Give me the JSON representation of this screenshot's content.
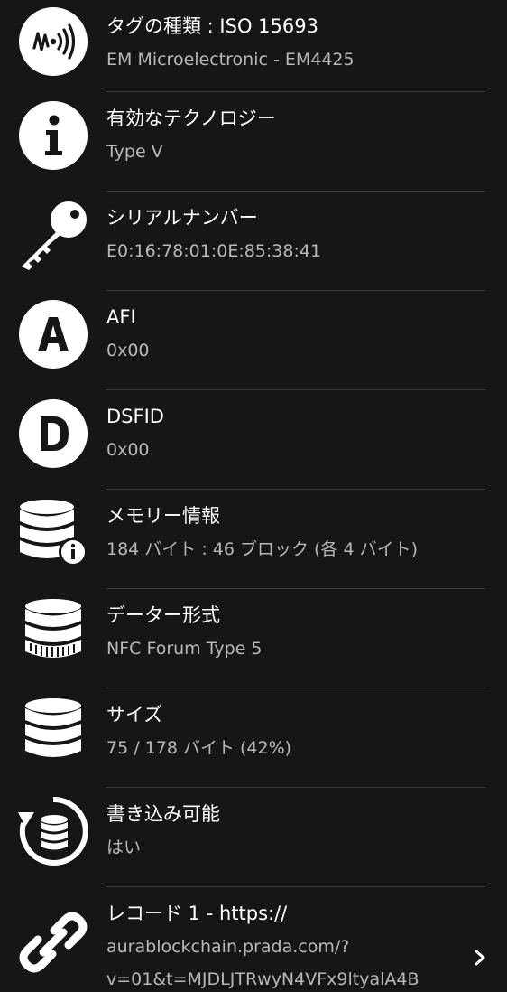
{
  "rows": [
    {
      "title": "タグの種類 : ISO 15693",
      "subtitle": "EM Microelectronic - EM4425",
      "icon": "nfc-tag-icon"
    },
    {
      "title": "有効なテクノロジー",
      "subtitle": "Type V",
      "icon": "info-icon"
    },
    {
      "title": "シリアルナンバー",
      "subtitle": "E0:16:78:01:0E:85:38:41",
      "icon": "key-icon"
    },
    {
      "title": "AFI",
      "subtitle": "0x00",
      "icon": "letter-a-icon"
    },
    {
      "title": "DSFID",
      "subtitle": "0x00",
      "icon": "letter-d-icon"
    },
    {
      "title": "メモリー情報",
      "subtitle": "184 バイト : 46 ブロック (各 4 バイト)",
      "icon": "database-info-icon"
    },
    {
      "title": "データー形式",
      "subtitle": "NFC Forum Type 5",
      "icon": "database-format-icon"
    },
    {
      "title": "サイズ",
      "subtitle": "75 / 178 バイト (42%)",
      "icon": "database-size-icon"
    },
    {
      "title": "書き込み可能",
      "subtitle": "はい",
      "icon": "writable-database-icon"
    },
    {
      "title": "レコード 1 - https://",
      "subtitle": "aurablockchain.prada.com/?",
      "subtitle2": "v=01&t=MJDLJTRwyN4VFx9ltyalA4B",
      "icon": "link-icon"
    }
  ]
}
